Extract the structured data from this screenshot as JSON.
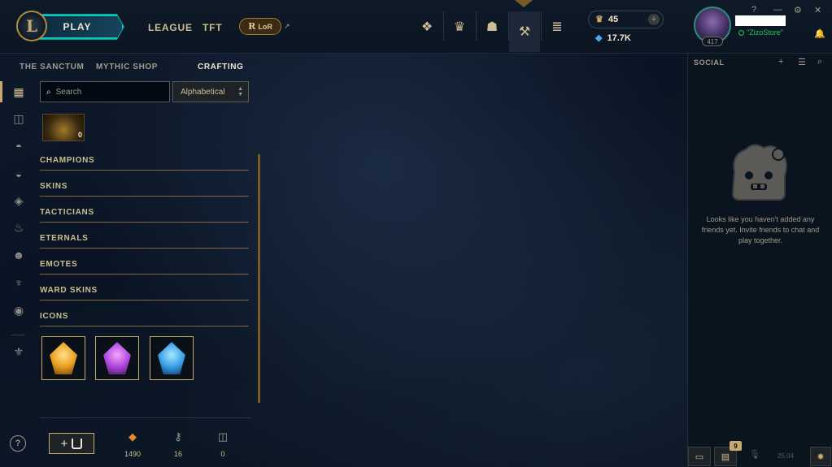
{
  "header": {
    "logo_letter": "L",
    "play_label": "PLAY",
    "nav": [
      {
        "label": "LEAGUE"
      },
      {
        "label": "TFT"
      }
    ],
    "lor_label": "LoR",
    "lor_glyph": "R",
    "external_glyph": "↗",
    "icons": [
      {
        "name": "clash-icon",
        "glyph": "❖"
      },
      {
        "name": "ranked-icon",
        "glyph": "♛"
      },
      {
        "name": "store-bag-icon",
        "glyph": "☗"
      },
      {
        "name": "crafting-hammer-icon",
        "glyph": "⚒"
      },
      {
        "name": "collection-coins-icon",
        "glyph": "≣"
      }
    ],
    "currency": {
      "rp": "45",
      "be": "17.7K",
      "rp_glyph": "♛",
      "be_glyph": "◆",
      "plus_glyph": "+"
    },
    "profile": {
      "level": "417",
      "status": "\"ZizoStore\""
    },
    "window_controls": {
      "help": "?",
      "minimize": "—",
      "settings": "⚙",
      "close": "✕"
    },
    "bell_glyph": "🔔"
  },
  "subnav": {
    "items": [
      {
        "label": "THE SANCTUM",
        "active": false
      },
      {
        "label": "MYTHIC SHOP",
        "active": false
      },
      {
        "label": "CRAFTING",
        "active": true
      }
    ]
  },
  "rail": {
    "icons": [
      {
        "name": "grid-icon",
        "glyph": "▦"
      },
      {
        "name": "chest-icon",
        "glyph": "◫"
      },
      {
        "name": "helmet-icon",
        "glyph": "◓"
      },
      {
        "name": "mask-icon",
        "glyph": "◒"
      },
      {
        "name": "eternal-icon",
        "glyph": "◈"
      },
      {
        "name": "flame-icon",
        "glyph": "♨"
      },
      {
        "name": "emote-icon",
        "glyph": "☻"
      },
      {
        "name": "ward-icon",
        "glyph": "♆"
      },
      {
        "name": "profile-icon",
        "glyph": "◉"
      },
      {
        "name": "hextech-icon",
        "glyph": "⚜"
      }
    ],
    "help_glyph": "?"
  },
  "crafting": {
    "search_placeholder": "Search",
    "search_glyph": "⌕",
    "sort_value": "Alphabetical",
    "sort_glyph_up": "▲",
    "sort_glyph_down": "▼",
    "chest_count": "0",
    "categories": [
      {
        "label": "CHAMPIONS"
      },
      {
        "label": "SKINS"
      },
      {
        "label": "TACTICIANS"
      },
      {
        "label": "ETERNALS"
      },
      {
        "label": "EMOTES"
      },
      {
        "label": "WARD SKINS"
      },
      {
        "label": "ICONS"
      }
    ],
    "icon_items": [
      {
        "name": "gold-icon-tile",
        "color": "#e8a020"
      },
      {
        "name": "purple-icon-tile",
        "color": "#b048e0"
      },
      {
        "name": "blue-icon-tile",
        "color": "#3aa0e8"
      }
    ],
    "craft_plus": "+",
    "resources": [
      {
        "name": "orange-essence",
        "glyph": "◆",
        "value": "1490",
        "color": "#e8862a"
      },
      {
        "name": "key",
        "glyph": "⚷",
        "value": "16",
        "color": "#a09b8c"
      },
      {
        "name": "chest",
        "glyph": "◫",
        "value": "0",
        "color": "#a09b8c"
      }
    ]
  },
  "social": {
    "title": "SOCIAL",
    "add_friend_glyph": "+",
    "list_glyph": "☰",
    "search_glyph": "⌕",
    "empty_message": "Looks like you haven't added any friends yet. Invite friends to chat and play together.",
    "chat_glyph": "▭",
    "notifications_glyph": "▤",
    "notifications_count": "9",
    "mic_glyph": "🎙",
    "version": "25.04",
    "bug_glyph": "✸"
  },
  "colors": {
    "gold": "#c8aa6e",
    "teal": "#0ac8b9",
    "text": "#cdbe91"
  }
}
